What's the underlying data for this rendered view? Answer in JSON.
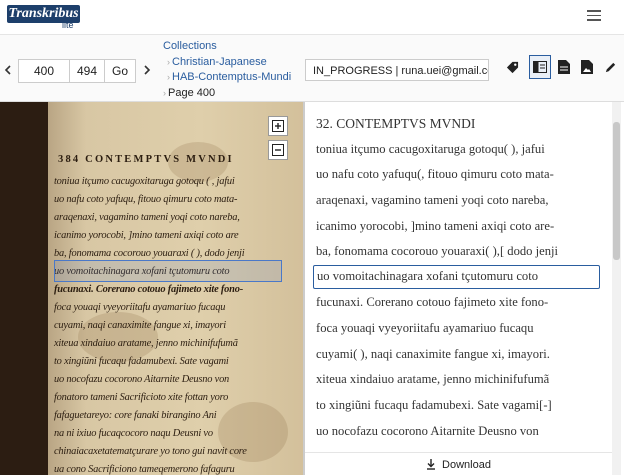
{
  "app": {
    "logo_text": "Transkribus",
    "logo_sub": "lite"
  },
  "toolbar": {
    "prev_icon": "chevron-left-icon",
    "next_icon": "chevron-right-icon",
    "page_input": "400",
    "page_total": "494",
    "go_label": "Go",
    "status": "IN_PROGRESS | runa.uei@gmail.com",
    "tools": [
      "tag-icon",
      "layout-sidebar-icon",
      "document-icon",
      "image-document-icon",
      "pen-icon"
    ]
  },
  "breadcrumb": [
    "Collections",
    "Christian-Japanese",
    "HAB-Contemptus-Mundi",
    "Page 400"
  ],
  "image": {
    "header": "384  CONTEMPTVS MVNDI",
    "lines": [
      "toniua itçumo cacugoxitaruga gotoqu ( , jafui",
      "uo nafu coto yafuqu, fitouo qimuru coto mata-",
      "araqenaxi, vagamino tameni yoqi coto nareba,",
      "icanimo yorocobi, ]mino tameni axiqi coto are",
      "ba, fonomama cocorouo youaraxi ( ), dodo jenji",
      "uo vomoitachinagara xofani tçutomuru coto",
      "fucunaxi. Corerano cotouo fajimeto xite fono-",
      "foca youaqi vyeyoriitafu ayamariuo fucaqu",
      "cuyami, naqi canaximite fangue xi, imayori",
      "xiteua xindaiuo aratame, jenno michinifufumã",
      "to xingiũni fucaqu fadamubexi. Sate vagami",
      "uo nocofazu cocorono Aitarnite Deusno von",
      "fonatoro tameni Sacrificioto xite fottan yoro",
      "fafaguetareyo: core fanaki birangino Ani",
      "na ni ixiuo fucaqcocoro naqu Deusni vo",
      "chinaiacaxetatematçurare yo tono gui navit core",
      "ua cono Sacrificiono tameqemerono fafaguru"
    ]
  },
  "transcript": {
    "lines": [
      "32. CONTEMPTVS MVNDI",
      "toniua itçumo cacugoxitaruga gotoqu( ), jafui",
      "uo nafu coto yafuqu(, fitouo qimuru coto mata-",
      "araqenaxi, vagamino tameni yoqi coto nareba,",
      "icanimo yorocobi, ]mino tameni axiqi coto are-",
      "ba, fonomama cocorouo youaraxi( ),[ dodo jenji",
      "uo vomoitachinagara xofani tçutomuru coto",
      "fucunaxi. Corerano cotouo fajimeto xite fono-",
      "foca youaqi vyeyoriitafu ayamariuo fucaqu",
      "cuyami( ), naqi canaximite fangue xi, imayori.",
      "xiteua xindaiuo aratame, jenno michinifufumã",
      "to xingiũni fucaqu fadamubexi. Sate vagami[-]",
      "uo nocofazu cocorono Aitarnite Deusno von"
    ],
    "selected_index": 6
  },
  "download": {
    "label": "Download",
    "icon": "download-icon"
  },
  "colors": {
    "accent": "#2a5d9f",
    "logo_bg": "#1d3f6b",
    "region": "#4a78c8",
    "paper": "#dfcfab"
  }
}
